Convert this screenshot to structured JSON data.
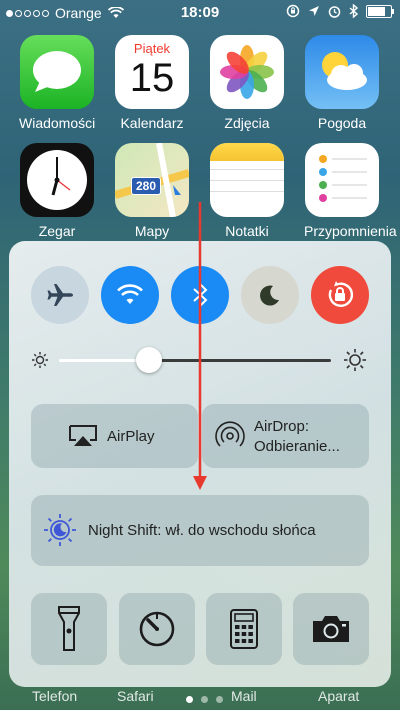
{
  "status_bar": {
    "carrier": "Orange",
    "time": "18:09"
  },
  "apps": [
    {
      "label": "Wiadomości",
      "icon": "messages-icon"
    },
    {
      "label": "Kalendarz",
      "icon": "calendar-icon",
      "day_name": "Piątek",
      "day_number": "15"
    },
    {
      "label": "Zdjęcia",
      "icon": "photos-icon"
    },
    {
      "label": "Pogoda",
      "icon": "weather-icon"
    },
    {
      "label": "Zegar",
      "icon": "clock-icon"
    },
    {
      "label": "Mapy",
      "icon": "maps-icon",
      "road_sign": "280"
    },
    {
      "label": "Notatki",
      "icon": "notes-icon"
    },
    {
      "label": "Przypomnienia",
      "icon": "reminders-icon"
    }
  ],
  "dock": [
    "Telefon",
    "Safari",
    "Mail",
    "Aparat"
  ],
  "control_center": {
    "toggles": [
      {
        "name": "airplane-mode",
        "color": "#c7d6df",
        "icon": "airplane-icon"
      },
      {
        "name": "wifi",
        "color": "#1a8bf5",
        "icon": "wifi-icon"
      },
      {
        "name": "bluetooth",
        "color": "#1a8bf5",
        "icon": "bluetooth-icon"
      },
      {
        "name": "do-not-disturb",
        "color": "#d6d7cf",
        "icon": "moon-icon"
      },
      {
        "name": "rotation-lock",
        "color": "#f04a3c",
        "icon": "rotation-lock-icon"
      }
    ],
    "brightness": 0.33,
    "airplay_label": "AirPlay",
    "airdrop_line1": "AirDrop:",
    "airdrop_line2": "Odbieranie...",
    "night_shift_label": "Night Shift: wł. do wschodu słońca",
    "tools": [
      "flashlight-icon",
      "timer-icon",
      "calculator-icon",
      "camera-icon"
    ]
  },
  "accent_red": "#e8392f"
}
